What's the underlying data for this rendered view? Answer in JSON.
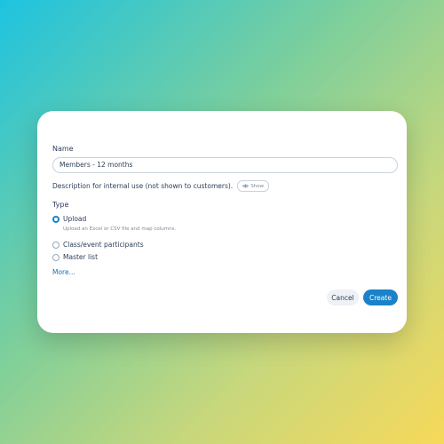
{
  "form": {
    "name_label": "Name",
    "name_value": "Members - 12 months",
    "description_label": "Description for internal use (not shown to customers).",
    "show_label": "Show",
    "type_label": "Type",
    "options": [
      {
        "label": "Upload",
        "hint": "Upload an Excel or CSV file and map columns.",
        "selected": true
      },
      {
        "label": "Class/event participants",
        "selected": false
      },
      {
        "label": "Master list",
        "selected": false
      }
    ],
    "more_label": "More..."
  },
  "actions": {
    "cancel_label": "Cancel",
    "create_label": "Create"
  },
  "colors": {
    "accent": "#1a82c9",
    "text": "#2c3e57",
    "muted": "#7d8a99"
  }
}
